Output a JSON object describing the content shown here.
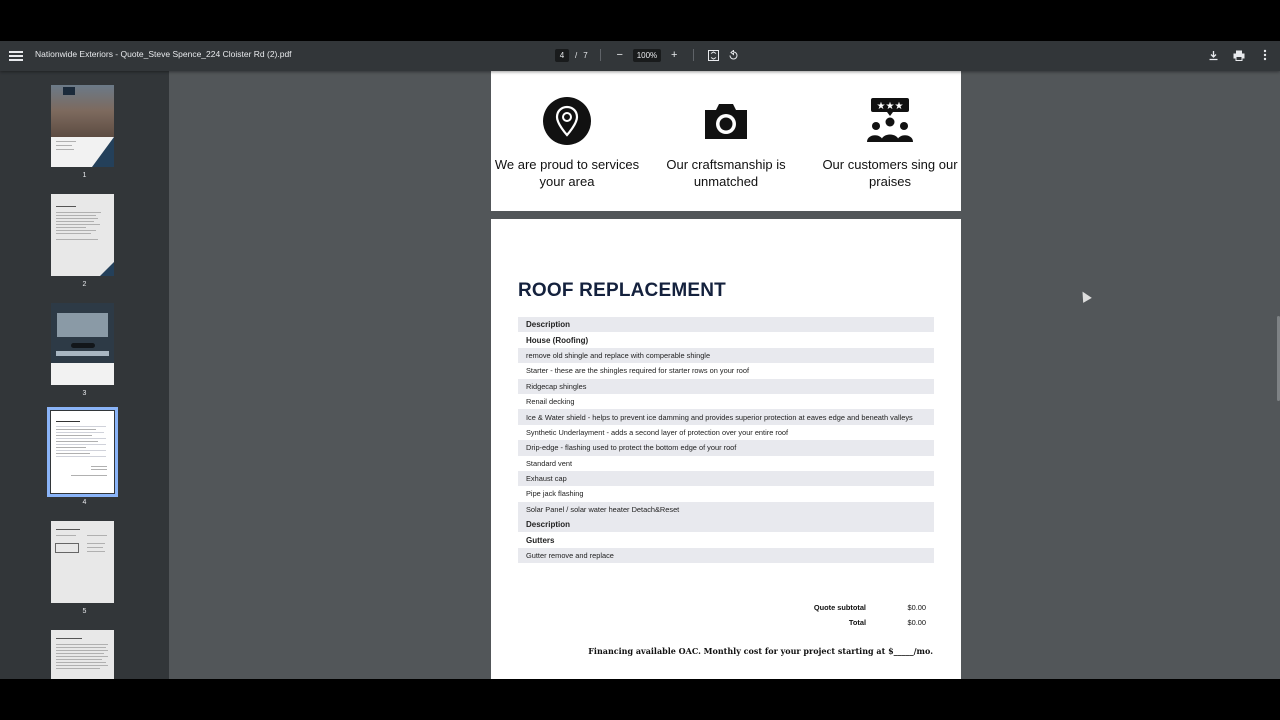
{
  "toolbar": {
    "title": "Nationwide Exteriors - Quote_Steve Spence_224 Cloister Rd (2).pdf",
    "page_current": "4",
    "page_separator": "/",
    "page_total": "7",
    "zoom": "100%",
    "zoom_out": "−",
    "zoom_in": "+"
  },
  "sidebar": {
    "pages": [
      "1",
      "2",
      "3",
      "4",
      "5"
    ]
  },
  "page3": {
    "features": [
      {
        "icon": "location-pin-icon",
        "text": "We are proud to services your area"
      },
      {
        "icon": "camera-icon",
        "text": "Our craftsmanship is unmatched"
      },
      {
        "icon": "customers-rating-icon",
        "text": "Our customers sing our praises"
      }
    ]
  },
  "page4": {
    "heading": "ROOF REPLACEMENT",
    "rows": [
      "Description",
      "House (Roofing)",
      "remove old shingle and replace with comperable shingle",
      "Starter - these are the shingles required for starter rows on your roof",
      "Ridgecap shingles",
      "Renail decking",
      "Ice & Water shield - helps to prevent ice damming and provides superior protection at eaves edge and beneath valleys",
      "Synthetic Underlayment - adds a second layer of protection over your entire roof",
      "Drip-edge - flashing used to protect the bottom edge of your roof",
      "Standard vent",
      "Exhaust cap",
      "Pipe jack flashing",
      "Solar Panel / solar water heater Detach&Reset",
      "Description",
      "Gutters",
      "Gutter remove and replace"
    ],
    "subtotal_label": "Quote subtotal",
    "subtotal_value": "$0.00",
    "total_label": "Total",
    "total_value": "$0.00",
    "financing": "Financing available OAC. Monthly cost for your project starting at $_____/mo."
  }
}
